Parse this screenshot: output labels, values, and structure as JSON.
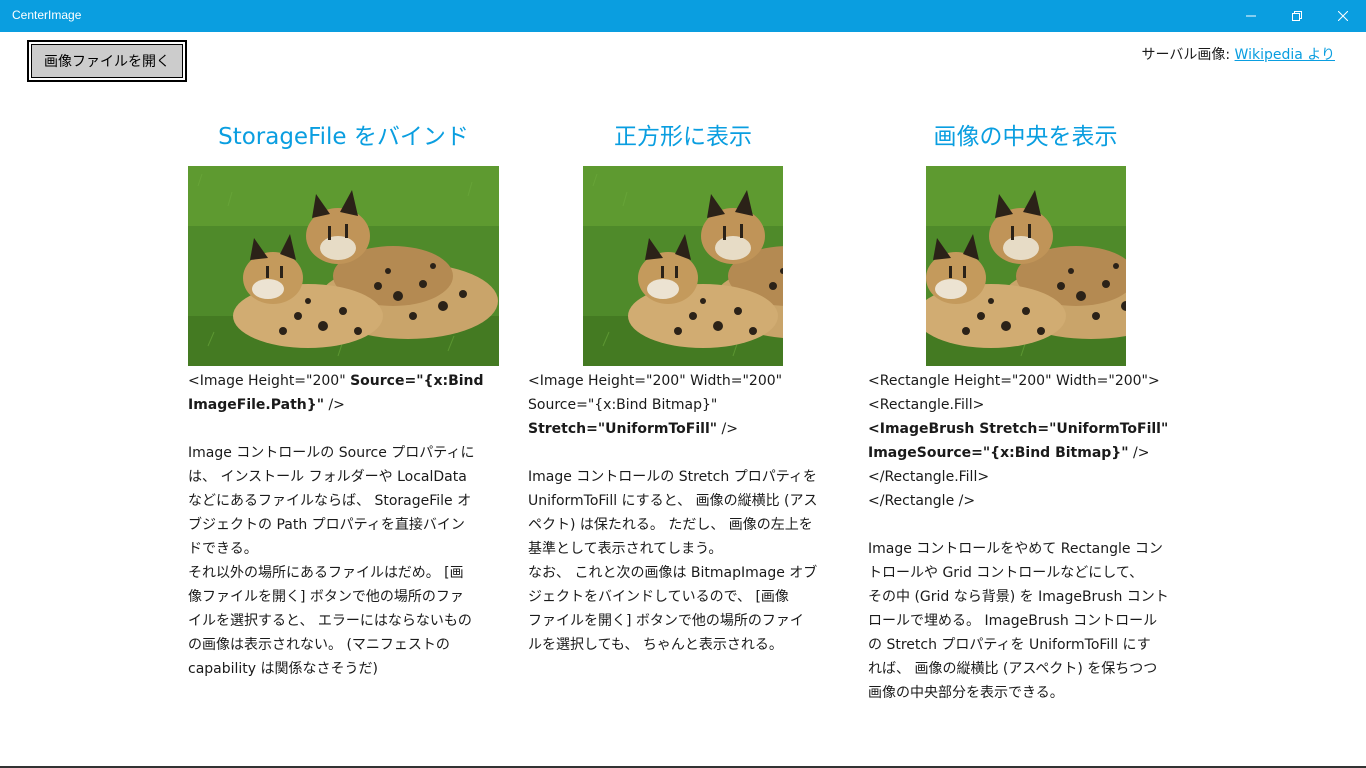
{
  "window": {
    "title": "CenterImage",
    "minimize_icon": "minimize-icon",
    "maximize_icon": "restore-icon",
    "close_icon": "close-icon",
    "titlebar_color": "#0a9ee0"
  },
  "toolbar": {
    "open_button_label": "画像ファイルを開く"
  },
  "credit": {
    "prefix": "サーバル画像: ",
    "link_text": "Wikipedia より"
  },
  "columns": [
    {
      "heading": "StorageFile をバインド",
      "image_alt": "serval photo",
      "code_lines": [
        {
          "plain": "<Image Height=\"200\" ",
          "bold": "Source=\"{x:Bind"
        },
        {
          "plain": "",
          "bold": "ImageFile.Path}\"",
          "tail": " />"
        }
      ],
      "description": "Image コントロールの Source プロパティに\nは、 インストール フォルダーや LocalData\nなどにあるファイルならば、 StorageFile オ\nブジェクトの Path プロパティを直接バイン\nドできる。\nそれ以外の場所にあるファイルはだめ。 [画\n像ファイルを開く] ボタンで他の場所のファ\nイルを選択すると、 エラーにはならないもの\nの画像は表示されない。 (マニフェストの\ncapability は関係なさそうだ)"
    },
    {
      "heading": "正方形に表示",
      "image_alt": "serval photo",
      "code_lines": [
        {
          "plain": "<Image Height=\"200\" Width=\"200\"",
          "bold": ""
        },
        {
          "plain": "Source=\"{x:Bind Bitmap}\"",
          "bold": ""
        },
        {
          "plain": "",
          "bold": "Stretch=\"UniformToFill\"",
          "tail": " />"
        }
      ],
      "description": "Image コントロールの Stretch プロパティを\nUniformToFill にすると、 画像の縦横比 (アス\nペクト) は保たれる。 ただし、 画像の左上を\n基準として表示されてしまう。\nなお、 これと次の画像は BitmapImage オブ\nジェクトをバインドしているので、 [画像\nファイルを開く] ボタンで他の場所のファイ\nルを選択しても、 ちゃんと表示される。"
    },
    {
      "heading": "画像の中央を表示",
      "image_alt": "serval photo",
      "code_lines": [
        {
          "plain": "<Rectangle Height=\"200\" Width=\"200\">",
          "bold": ""
        },
        {
          "plain": "<Rectangle.Fill>",
          "bold": ""
        },
        {
          "plain": "",
          "bold": "<ImageBrush Stretch=\"UniformToFill\""
        },
        {
          "plain": "",
          "bold": "ImageSource=\"{x:Bind Bitmap}\"",
          "tail": " />"
        },
        {
          "plain": "</Rectangle.Fill>",
          "bold": ""
        },
        {
          "plain": "</Rectangle />",
          "bold": ""
        }
      ],
      "description": "Image コントロールをやめて Rectangle コン\nトロールや Grid コントロールなどにして、\nその中 (Grid なら背景) を ImageBrush コント\nロールで埋める。 ImageBrush コントロール\nの Stretch プロパティを UniformToFill にす\nれば、 画像の縦横比 (アスペクト) を保ちつつ\n画像の中央部分を表示できる。"
    }
  ]
}
